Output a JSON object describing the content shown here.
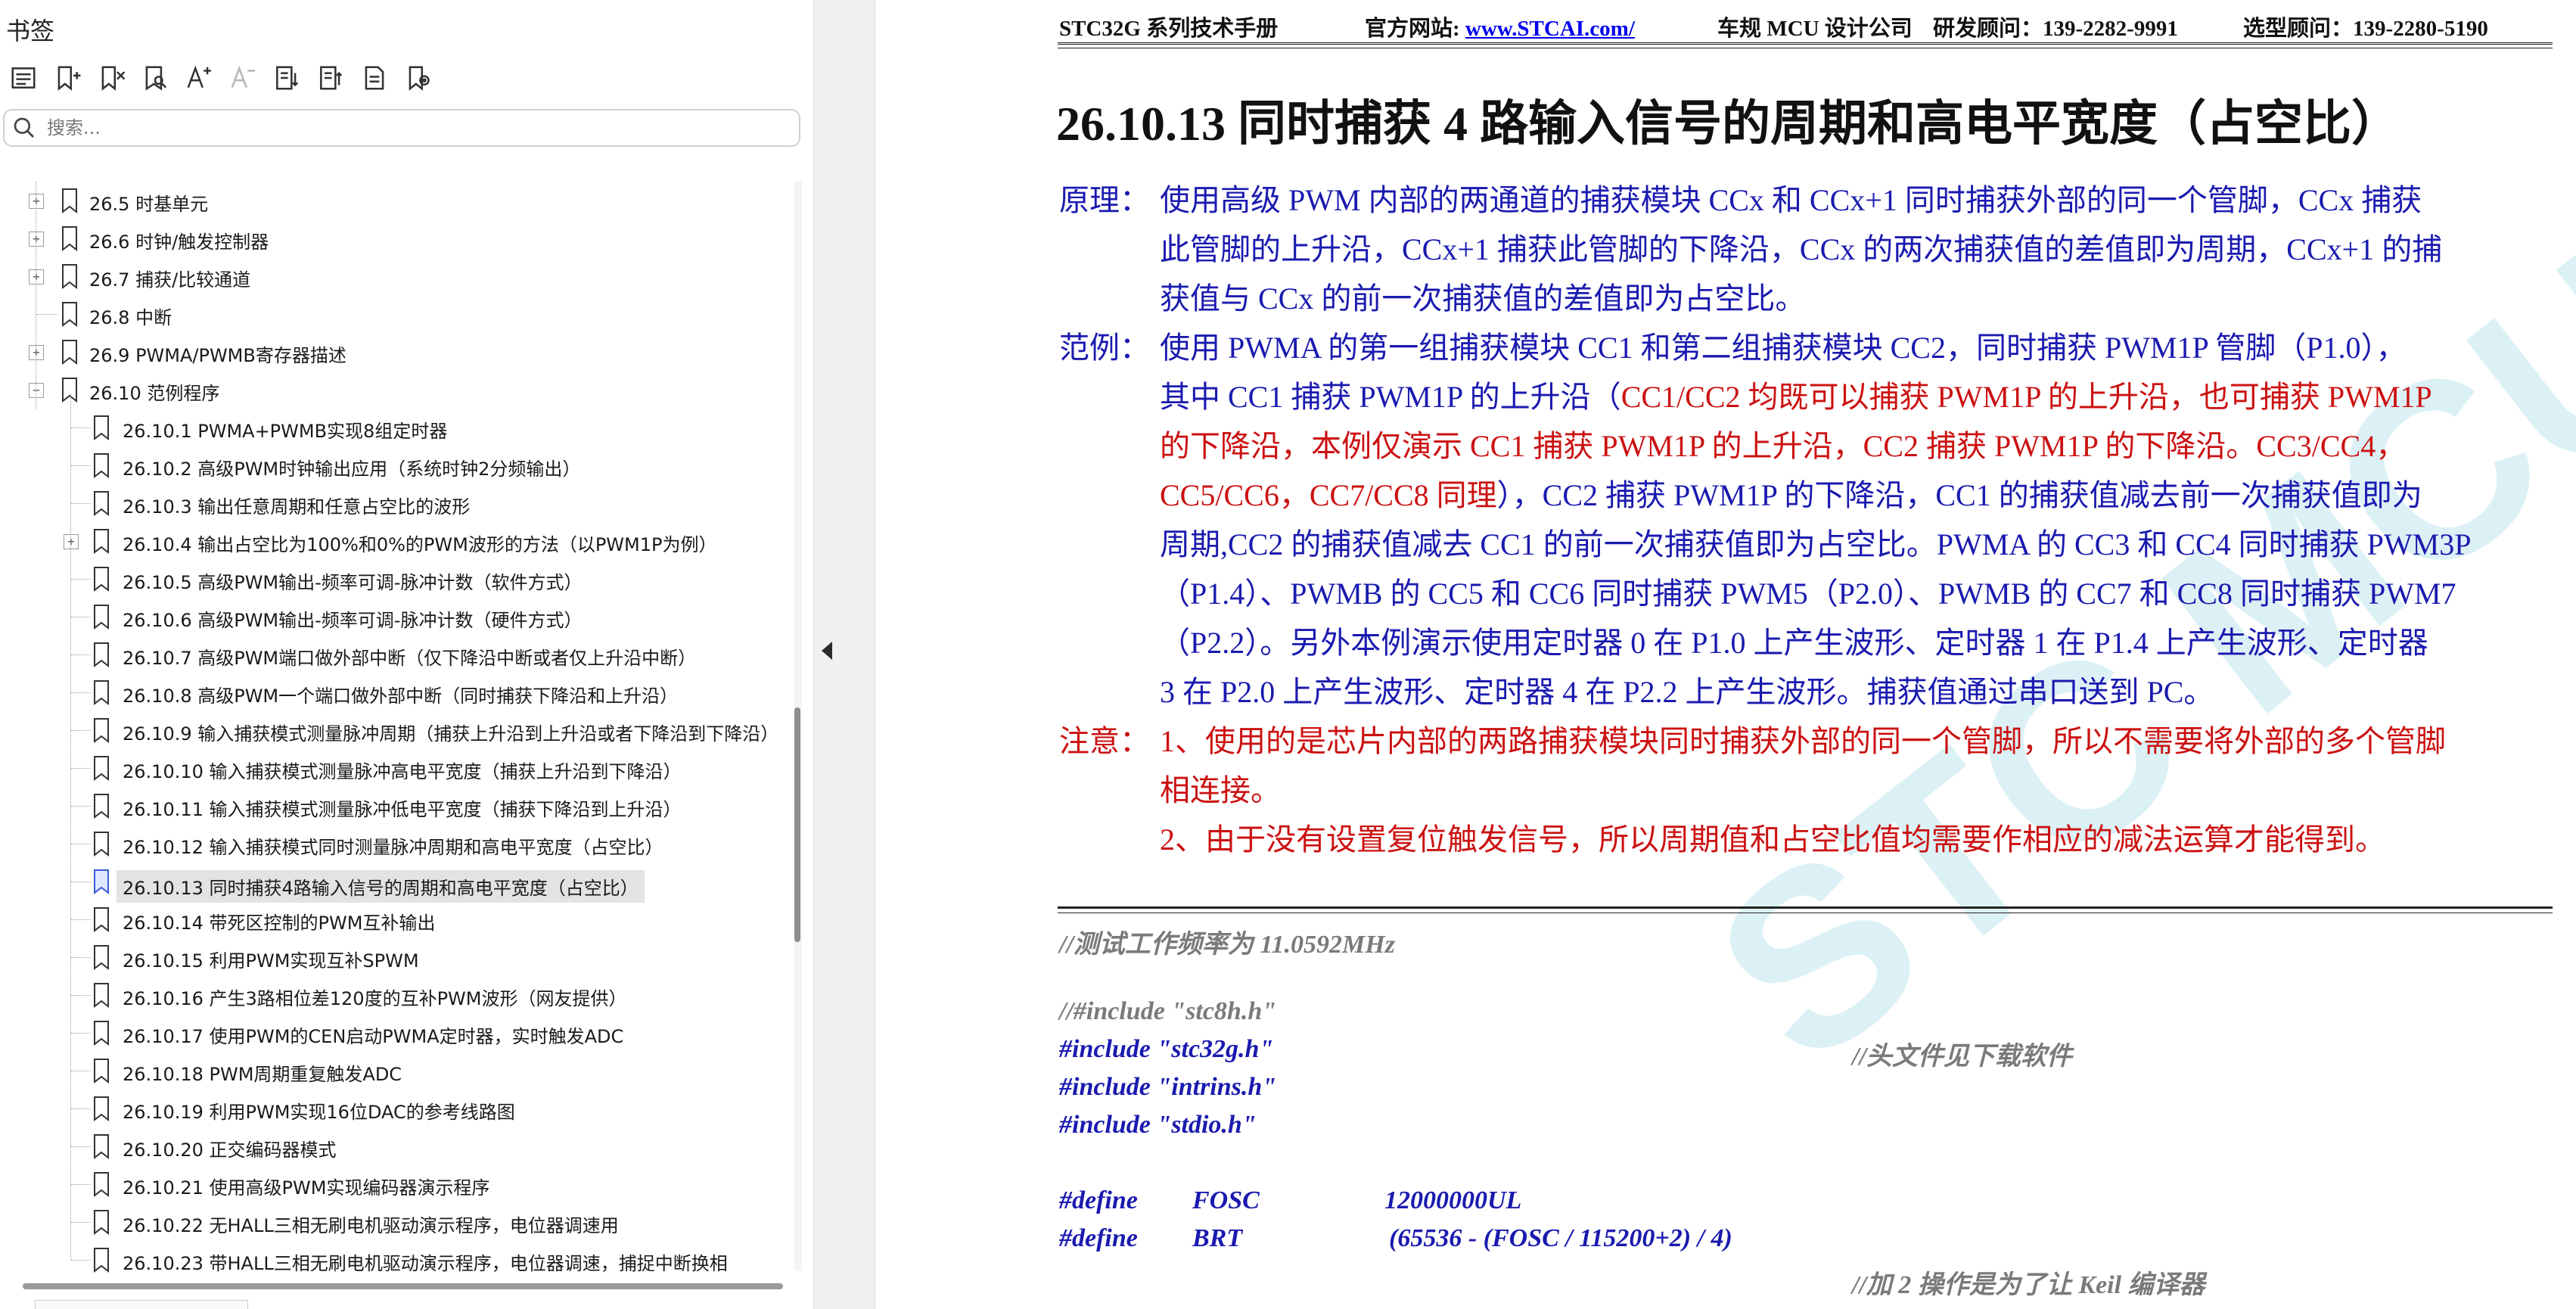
{
  "sidebar": {
    "title": "书签",
    "toolbar_icons": [
      "bookmark-list-icon",
      "bookmark-add-icon",
      "bookmark-delete-icon",
      "bookmark-find-icon",
      "font-increase-icon",
      "font-decrease-icon",
      "expand-all-icon",
      "collapse-all-icon",
      "bookmark-properties-icon",
      "bookmark-goto-icon"
    ],
    "search_placeholder": "搜索...",
    "items": [
      {
        "label": "26.5 时基单元",
        "level": 1,
        "expander": "+"
      },
      {
        "label": "26.6 时钟/触发控制器",
        "level": 1,
        "expander": "+"
      },
      {
        "label": "26.7 捕获/比较通道",
        "level": 1,
        "expander": "+"
      },
      {
        "label": "26.8 中断",
        "level": 1,
        "expander": ""
      },
      {
        "label": "26.9  PWMA/PWMB寄存器描述",
        "level": 1,
        "expander": "+"
      },
      {
        "label": "26.10  范例程序",
        "level": 1,
        "expander": "−"
      },
      {
        "label": "26.10.1 PWMA+PWMB实现8组定时器",
        "level": 2,
        "expander": ""
      },
      {
        "label": "26.10.2 高级PWM时钟输出应用（系统时钟2分频输出）",
        "level": 2,
        "expander": ""
      },
      {
        "label": "26.10.3 输出任意周期和任意占空比的波形",
        "level": 2,
        "expander": ""
      },
      {
        "label": "26.10.4  输出占空比为100%和0%的PWM波形的方法（以PWM1P为例）",
        "level": 2,
        "expander": "+"
      },
      {
        "label": "26.10.5 高级PWM输出-频率可调-脉冲计数（软件方式）",
        "level": 2,
        "expander": ""
      },
      {
        "label": "26.10.6 高级PWM输出-频率可调-脉冲计数（硬件方式）",
        "level": 2,
        "expander": ""
      },
      {
        "label": "26.10.7 高级PWM端口做外部中断（仅下降沿中断或者仅上升沿中断）",
        "level": 2,
        "expander": ""
      },
      {
        "label": "26.10.8 高级PWM一个端口做外部中断（同时捕获下降沿和上升沿）",
        "level": 2,
        "expander": ""
      },
      {
        "label": "26.10.9 输入捕获模式测量脉冲周期（捕获上升沿到上升沿或者下降沿到下降沿）",
        "level": 2,
        "expander": ""
      },
      {
        "label": "26.10.10  输入捕获模式测量脉冲高电平宽度（捕获上升沿到下降沿）",
        "level": 2,
        "expander": ""
      },
      {
        "label": "26.10.11  输入捕获模式测量脉冲低电平宽度（捕获下降沿到上升沿）",
        "level": 2,
        "expander": ""
      },
      {
        "label": "26.10.12  输入捕获模式同时测量脉冲周期和高电平宽度（占空比）",
        "level": 2,
        "expander": ""
      },
      {
        "label": "26.10.13  同时捕获4路输入信号的周期和高电平宽度（占空比）",
        "level": 2,
        "expander": "",
        "selected": true
      },
      {
        "label": "26.10.14 带死区控制的PWM互补输出",
        "level": 2,
        "expander": ""
      },
      {
        "label": "26.10.15 利用PWM实现互补SPWM",
        "level": 2,
        "expander": ""
      },
      {
        "label": "26.10.16  产生3路相位差120度的互补PWM波形（网友提供）",
        "level": 2,
        "expander": ""
      },
      {
        "label": "26.10.17 使用PWM的CEN启动PWMA定时器，实时触发ADC",
        "level": 2,
        "expander": ""
      },
      {
        "label": "26.10.18 PWM周期重复触发ADC",
        "level": 2,
        "expander": ""
      },
      {
        "label": "26.10.19 利用PWM实现16位DAC的参考线路图",
        "level": 2,
        "expander": ""
      },
      {
        "label": "26.10.20 正交编码器模式",
        "level": 2,
        "expander": ""
      },
      {
        "label": "26.10.21 使用高级PWM实现编码器演示程序",
        "level": 2,
        "expander": ""
      },
      {
        "label": "26.10.22 无HALL三相无刷电机驱动演示程序，电位器调速用",
        "level": 2,
        "expander": ""
      },
      {
        "label": "26.10.23 带HALL三相无刷电机驱动演示程序，电位器调速，捕捉中断换相",
        "level": 2,
        "expander": ""
      }
    ]
  },
  "document": {
    "header": {
      "manual": "STC32G 系列技术手册",
      "site_label": "官方网站: ",
      "site_url": "www.STCAI.com/",
      "company": "车规 MCU 设计公司",
      "rd_contact": "研发顾问：139-2282-9991",
      "sales_contact": "选型顾问：139-2280-5190"
    },
    "watermark": "STC MCU",
    "section_title": "26.10.13  同时捕获 4 路输入信号的周期和高电平宽度（占空比）",
    "principle": {
      "label": "原理：",
      "lines": [
        "使用高级 PWM 内部的两通道的捕获模块 CCx 和 CCx+1 同时捕获外部的同一个管脚，CCx 捕获",
        "此管脚的上升沿，CCx+1 捕获此管脚的下降沿，CCx 的两次捕获值的差值即为周期，CCx+1 的捕",
        "获值与 CCx 的前一次捕获值的差值即为占空比。"
      ]
    },
    "example": {
      "label": "范例：",
      "line1": "使用 PWMA 的第一组捕获模块 CC1 和第二组捕获模块 CC2，同时捕获 PWM1P 管脚（P1.0），",
      "line2_blue": "其中 CC1 捕获 PWM1P 的上升沿（",
      "line2_red": "CC1/CC2 均既可以捕获 PWM1P 的上升沿，也可捕获 PWM1P",
      "line3_red": "的下降沿，本例仅演示 CC1 捕获 PWM1P 的上升沿，CC2 捕获 PWM1P 的下降沿。CC3/CC4，",
      "line4_red": "CC5/CC6，CC7/CC8 同理",
      "line4_blue": "），CC2 捕获 PWM1P 的下降沿，CC1 的捕获值减去前一次捕获值即为",
      "line5": "周期,CC2 的捕获值减去 CC1 的前一次捕获值即为占空比。PWMA 的 CC3 和 CC4 同时捕获 PWM3P",
      "line6": "（P1.4）、PWMB 的 CC5 和 CC6 同时捕获 PWM5（P2.0）、PWMB 的 CC7 和 CC8 同时捕获 PWM7",
      "line7": "（P2.2）。另外本例演示使用定时器 0 在 P1.0 上产生波形、定时器 1 在 P1.4 上产生波形、定时器",
      "line8": "3 在 P2.0 上产生波形、定时器 4 在 P2.2 上产生波形。捕获值通过串口送到 PC。"
    },
    "note": {
      "label": "注意：",
      "line1": "1、使用的是芯片内部的两路捕获模块同时捕获外部的同一个管脚，所以不需要将外部的多个管脚",
      "line2": "相连接。",
      "line3": "2、由于没有设置复位触发信号，所以周期值和占空比值均需要作相应的减法运算才能得到。"
    },
    "code": {
      "freq_comment": "//测试工作频率为 11.0592MHz",
      "inc_comment": "//#include \"stc8h.h\"",
      "inc1": "#include \"stc32g.h\"",
      "inc1_comment": "//头文件见下载软件",
      "inc2": "#include \"intrins.h\"",
      "inc3": "#include \"stdio.h\"",
      "def1_kw": "#define",
      "def1_name": "FOSC",
      "def1_val": "12000000UL",
      "def2_kw": "#define",
      "def2_name": "BRT",
      "def2_val": "(65536 - (FOSC / 115200+2) / 4)",
      "last_comment": "//加 2 操作是为了让 Keil 编译器"
    }
  }
}
